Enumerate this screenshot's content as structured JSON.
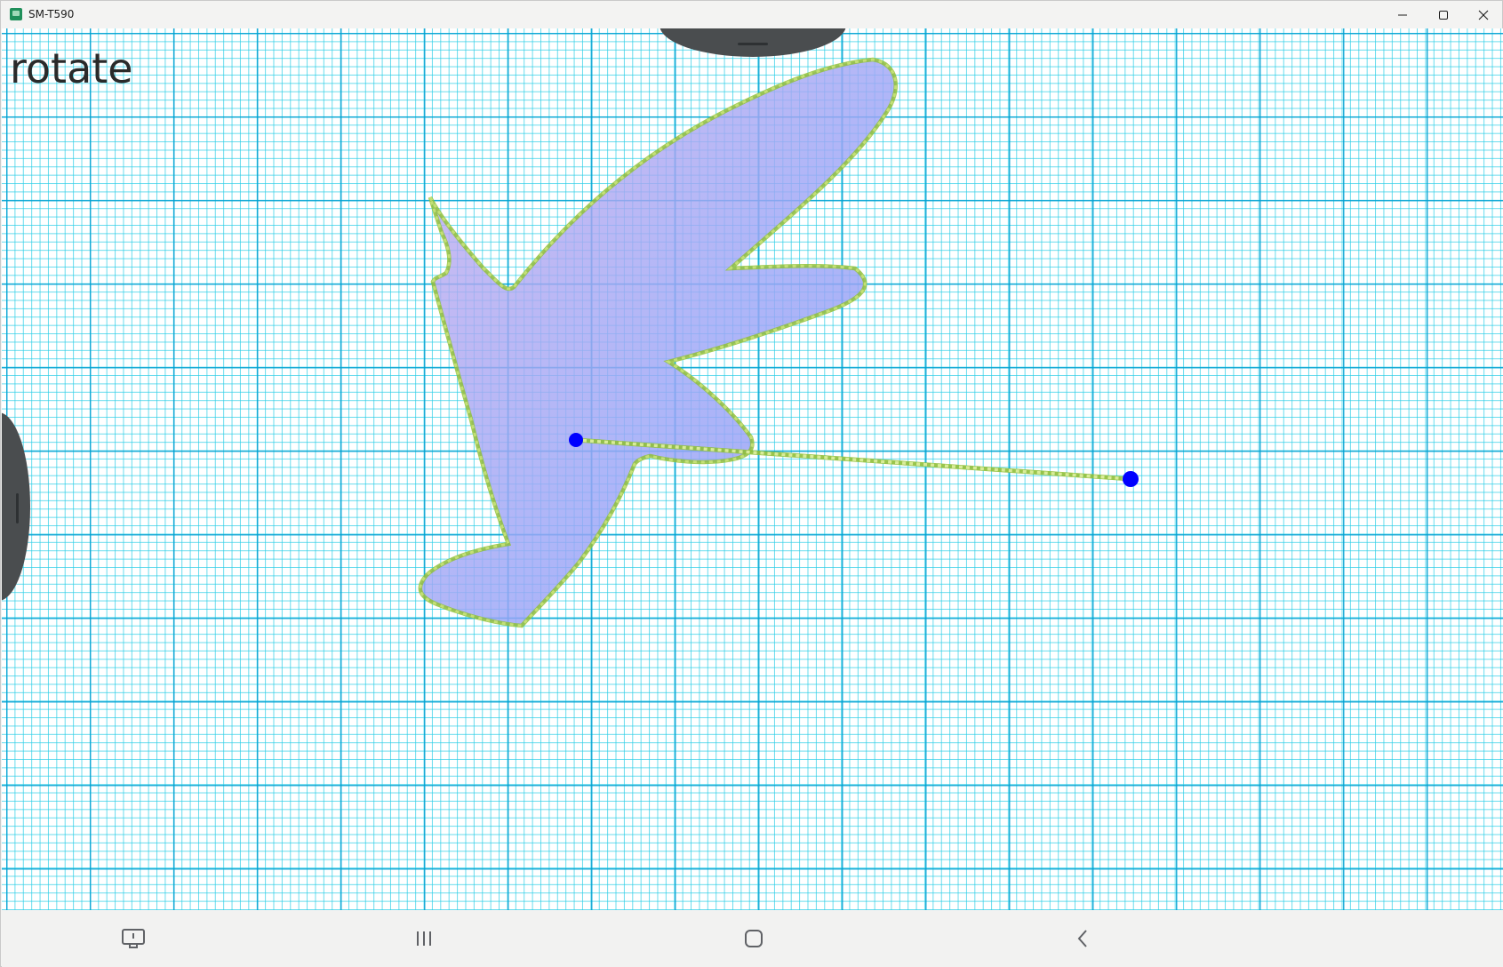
{
  "window": {
    "title": "SM-T590",
    "controls": {
      "minimize_icon": "minimize-icon",
      "maximize_icon": "maximize-icon",
      "close_icon": "close-icon"
    }
  },
  "canvas": {
    "mode_label": "rotate",
    "grid_color_major": "#00a0d2",
    "grid_color_minor": "#28cde6",
    "shape_fill": "#a6a6f5",
    "outline_color": "#9acd32",
    "point_color": "#0000ff"
  },
  "navbar": {
    "items": [
      {
        "icon": "screenshot-icon"
      },
      {
        "icon": "recent-apps-icon"
      },
      {
        "icon": "home-icon"
      },
      {
        "icon": "back-icon"
      }
    ]
  }
}
